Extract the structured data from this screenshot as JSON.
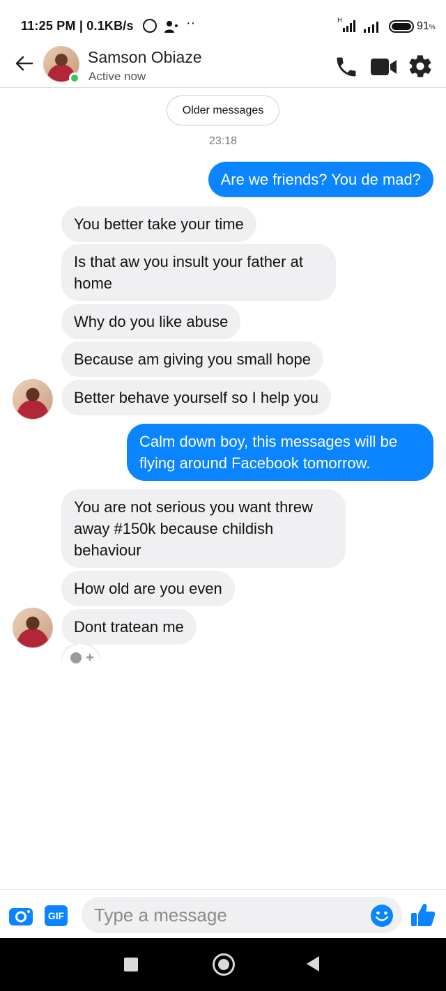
{
  "status_bar": {
    "time_speed": "11:25 PM | 0.1KB/s",
    "more": "··",
    "network_type": "H",
    "battery": "91"
  },
  "header": {
    "contact_name": "Samson Obiaze",
    "status": "Active now"
  },
  "conversation": {
    "older_messages_label": "Older messages",
    "timestamp": "23:18",
    "messages": [
      {
        "from": "me",
        "text": "Are we friends? You de mad?"
      },
      {
        "from": "them",
        "text": "You better take your time"
      },
      {
        "from": "them",
        "text": "Is that aw you insult your father at home"
      },
      {
        "from": "them",
        "text": "Why do you like abuse"
      },
      {
        "from": "them",
        "text": "Because am giving you small hope"
      },
      {
        "from": "them",
        "text": "Better behave yourself so I help you"
      },
      {
        "from": "me",
        "text": "Calm down boy, this messages will be flying around Facebook tomorrow."
      },
      {
        "from": "them",
        "text": "You are not serious you want threw away #150k because childish behaviour"
      },
      {
        "from": "them",
        "text": "How old are you even"
      },
      {
        "from": "them",
        "text": "Dont tratean me"
      }
    ]
  },
  "composer": {
    "placeholder": "Type a message",
    "gif_label": "GIF",
    "icons": [
      "camera-icon",
      "gif-icon",
      "emoji-icon",
      "like-icon"
    ]
  },
  "nav_bar": {
    "icons": [
      "recents-icon",
      "home-icon",
      "back-icon"
    ]
  },
  "colors": {
    "accent": "#0a84ff",
    "incoming_bubble": "#f0f0f2",
    "online": "#31c95a"
  }
}
